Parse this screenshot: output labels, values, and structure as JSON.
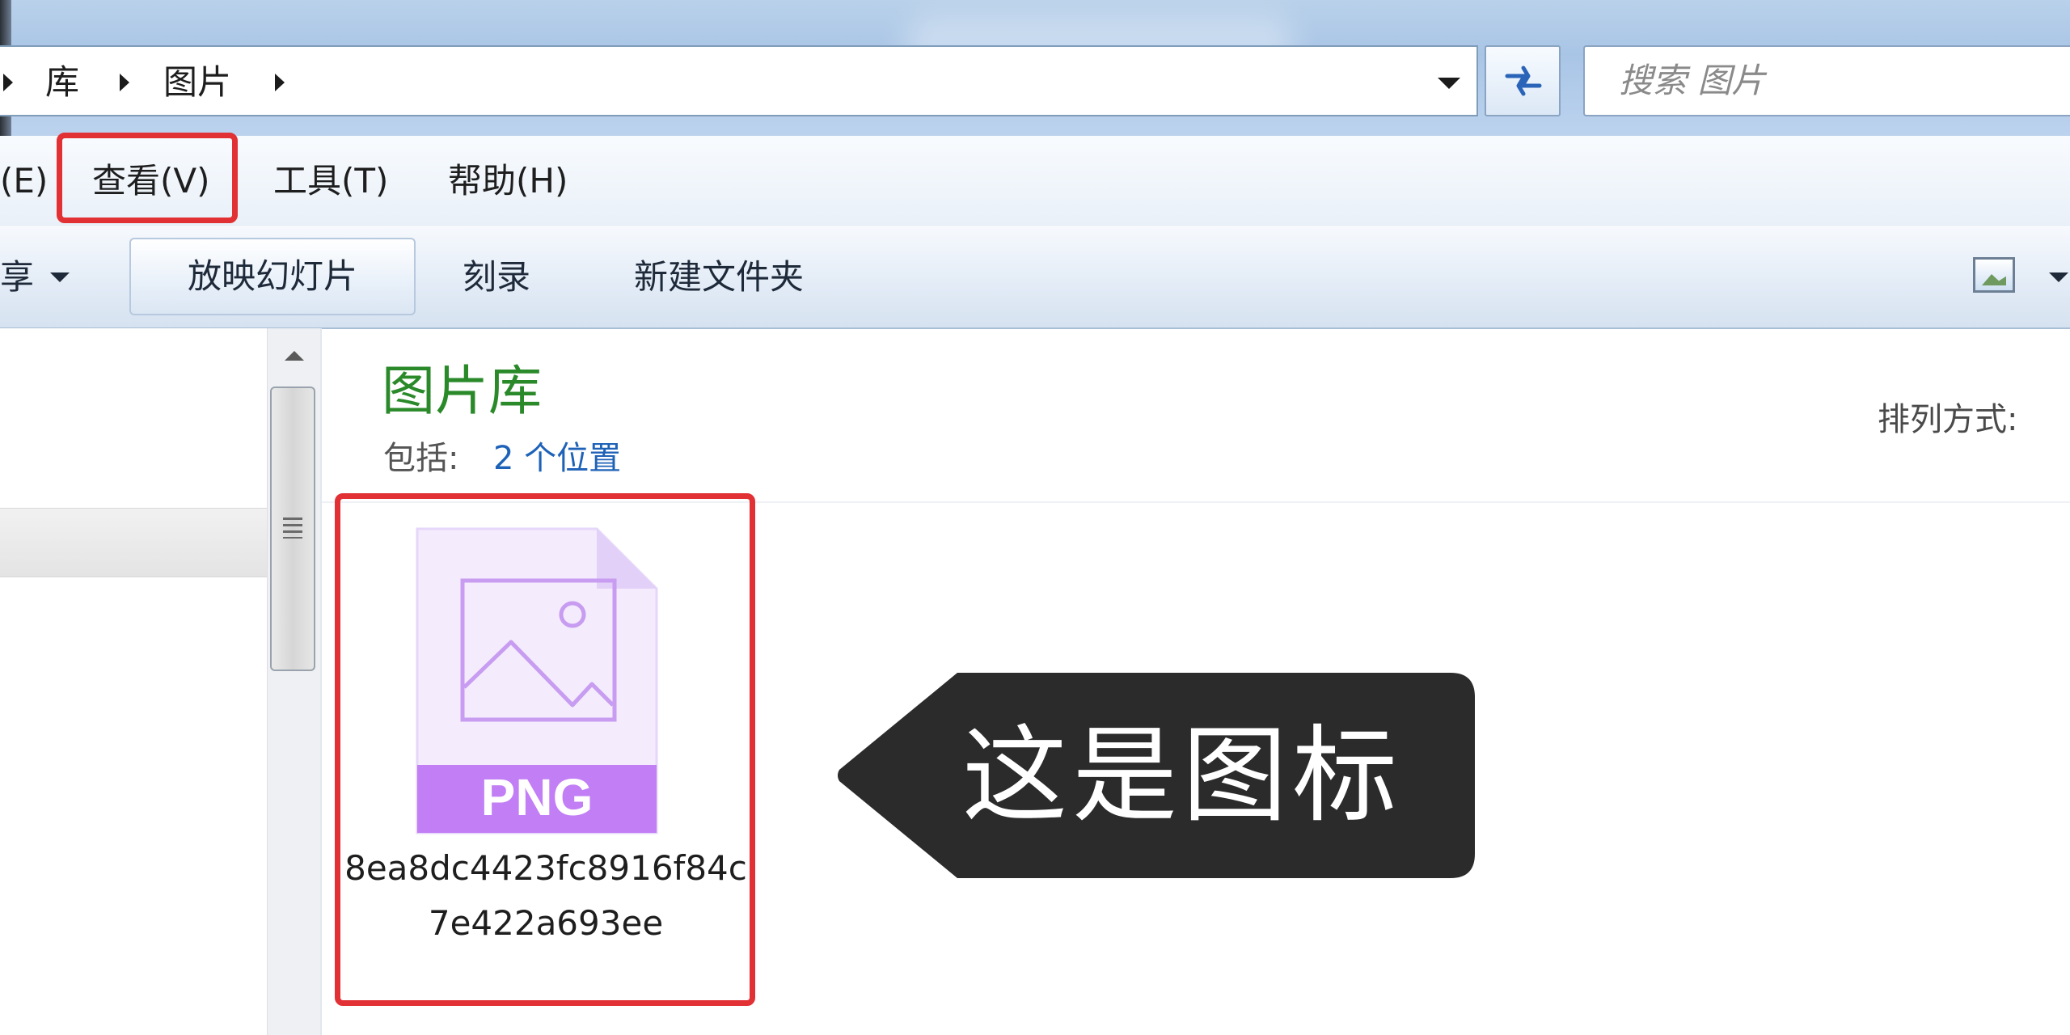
{
  "address": {
    "crumbs": [
      "库",
      "图片"
    ],
    "search_placeholder": "搜索 图片"
  },
  "menu": {
    "items": [
      "(E)",
      "查看(V)",
      "工具(T)",
      "帮助(H)"
    ]
  },
  "toolbar": {
    "share_partial": "享",
    "slideshow": "放映幻灯片",
    "burn": "刻录",
    "new_folder": "新建文件夹"
  },
  "library": {
    "title": "图片库",
    "include_label": "包括:",
    "include_link": "2 个位置",
    "arrange_label": "排列方式:"
  },
  "file": {
    "badge": "PNG",
    "name": "8ea8dc4423fc8916f84c7e422a693ee"
  },
  "callout": {
    "text": "这是图标"
  },
  "colors": {
    "highlight": "#e13134",
    "library_title": "#2a8a2a",
    "link": "#1e62b8",
    "png_badge": "#c27ef5",
    "callout_bg": "#2b2b2b"
  }
}
